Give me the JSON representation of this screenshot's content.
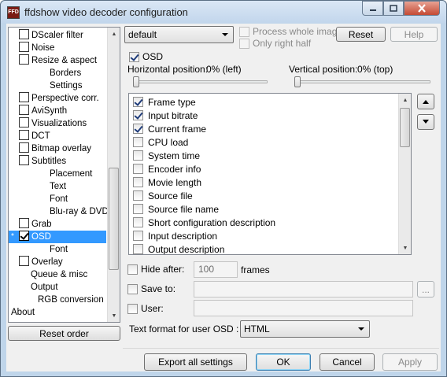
{
  "window": {
    "title": "ffdshow video decoder configuration",
    "icon_label": "FFD"
  },
  "tree": {
    "items": [
      {
        "label": "DScaler filter",
        "indent": 0,
        "checkbox": true,
        "checked": false
      },
      {
        "label": "Noise",
        "indent": 0,
        "checkbox": true,
        "checked": false
      },
      {
        "label": "Resize & aspect",
        "indent": 0,
        "checkbox": true,
        "checked": false
      },
      {
        "label": "Borders",
        "indent": 2,
        "checkbox": false
      },
      {
        "label": "Settings",
        "indent": 2,
        "checkbox": false
      },
      {
        "label": "Perspective corr.",
        "indent": 0,
        "checkbox": true,
        "checked": false
      },
      {
        "label": "AviSynth",
        "indent": 0,
        "checkbox": true,
        "checked": false
      },
      {
        "label": "Visualizations",
        "indent": 0,
        "checkbox": true,
        "checked": false
      },
      {
        "label": "DCT",
        "indent": 0,
        "checkbox": true,
        "checked": false
      },
      {
        "label": "Bitmap overlay",
        "indent": 0,
        "checkbox": true,
        "checked": false
      },
      {
        "label": "Subtitles",
        "indent": 0,
        "checkbox": true,
        "checked": false
      },
      {
        "label": "Placement",
        "indent": 2,
        "checkbox": false
      },
      {
        "label": "Text",
        "indent": 2,
        "checkbox": false
      },
      {
        "label": "Font",
        "indent": 2,
        "checkbox": false
      },
      {
        "label": "Blu-ray & DVD",
        "indent": 2,
        "checkbox": false
      },
      {
        "label": "Grab",
        "indent": 0,
        "checkbox": true,
        "checked": false
      },
      {
        "label": "OSD",
        "indent": 0,
        "checkbox": true,
        "checked": true,
        "selected": true,
        "marker": "*"
      },
      {
        "label": "Font",
        "indent": 2,
        "checkbox": false
      },
      {
        "label": "Overlay",
        "indent": 0,
        "checkbox": true,
        "checked": false
      },
      {
        "label": "Queue & misc",
        "indent": 1,
        "checkbox": false
      },
      {
        "label": "Output",
        "indent": 1,
        "checkbox": false
      },
      {
        "label": "RGB conversion",
        "indent": 1.5,
        "checkbox": false
      },
      {
        "label": "About",
        "indent": -1,
        "checkbox": false
      }
    ]
  },
  "reset_order_label": "Reset order",
  "preset": {
    "value": "default"
  },
  "process_whole_image": "Process whole image",
  "only_right_half": "Only right half",
  "reset_label": "Reset",
  "help_label": "Help",
  "osd": {
    "enable_label": "OSD",
    "horizontal_label": "Horizontal position:",
    "horizontal_value": "0% (left)",
    "vertical_label": "Vertical position:",
    "vertical_value": "0% (top)",
    "items": [
      {
        "label": "Frame type",
        "checked": true
      },
      {
        "label": "Input bitrate",
        "checked": true
      },
      {
        "label": "Current frame",
        "checked": true
      },
      {
        "label": "CPU load",
        "checked": false
      },
      {
        "label": "System time",
        "checked": false
      },
      {
        "label": "Encoder info",
        "checked": false
      },
      {
        "label": "Movie length",
        "checked": false
      },
      {
        "label": "Source file",
        "checked": false
      },
      {
        "label": "Source file name",
        "checked": false
      },
      {
        "label": "Short configuration description",
        "checked": false
      },
      {
        "label": "Input description",
        "checked": false
      },
      {
        "label": "Output description",
        "checked": false
      }
    ],
    "hide_after_label": "Hide after:",
    "hide_after_value": "100",
    "frames_label": "frames",
    "save_to_label": "Save to:",
    "browse_label": "...",
    "user_label": "User:",
    "text_format_label": "Text format for user OSD :",
    "text_format_value": "HTML"
  },
  "footer": {
    "export_label": "Export all settings",
    "ok_label": "OK",
    "cancel_label": "Cancel",
    "apply_label": "Apply"
  }
}
